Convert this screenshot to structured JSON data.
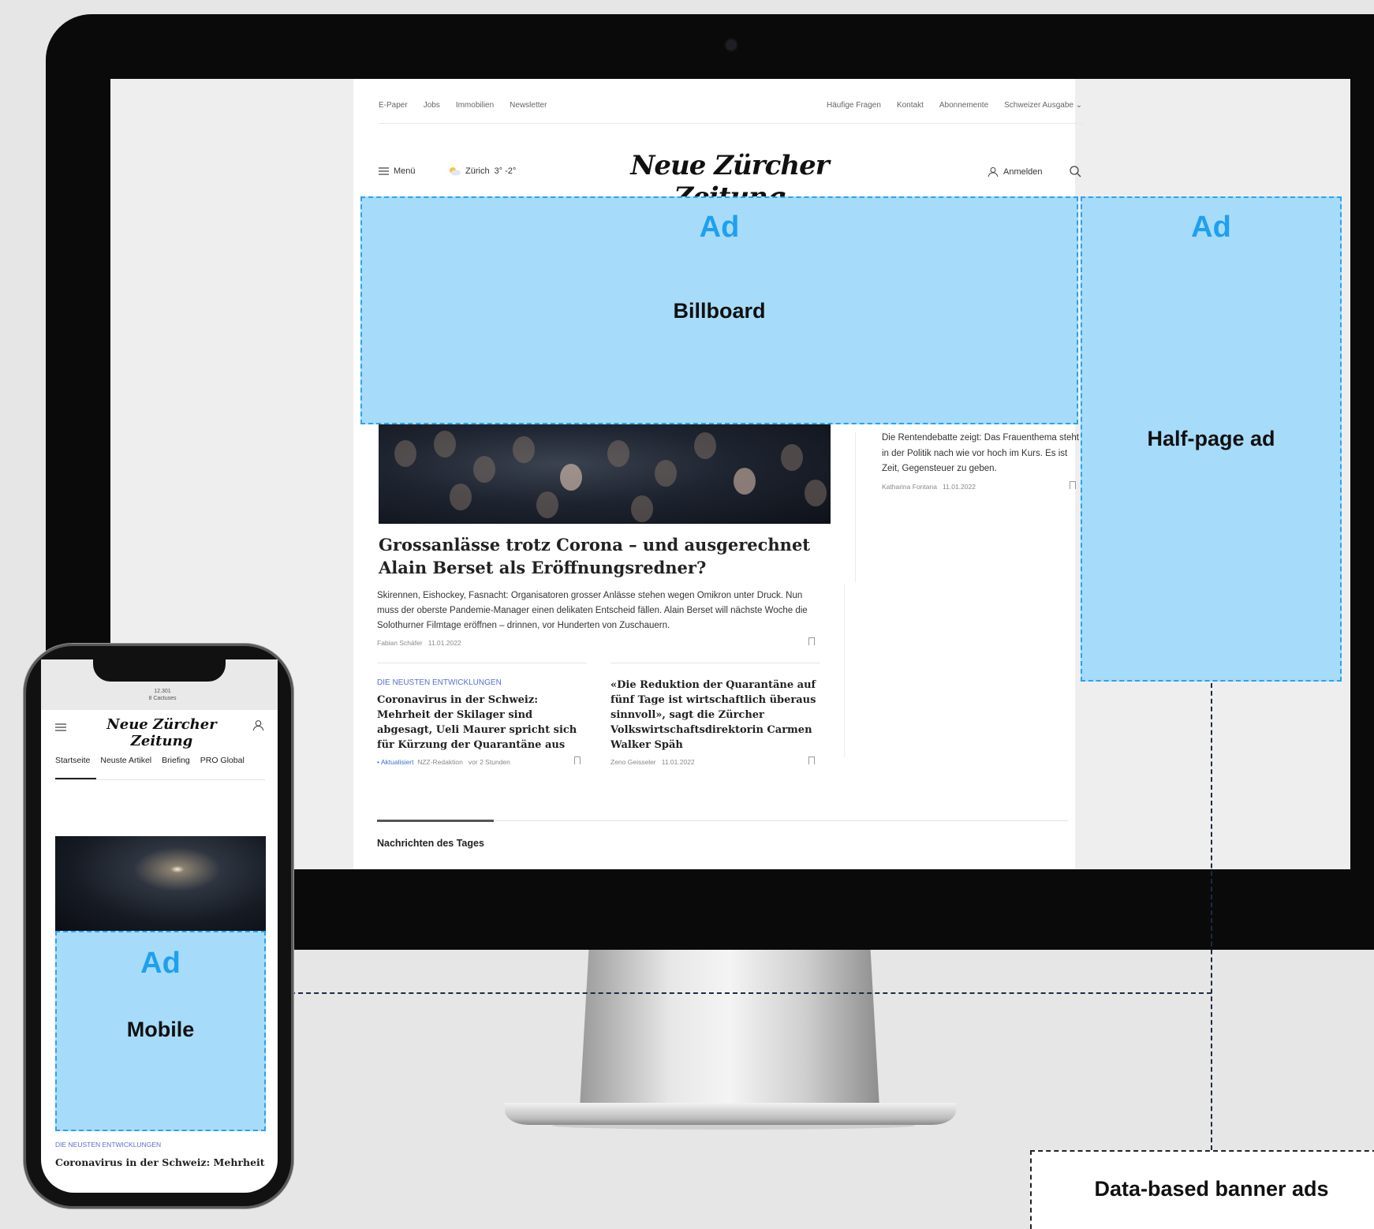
{
  "top_links_left": [
    "E-Paper",
    "Jobs",
    "Immobilien",
    "Newsletter"
  ],
  "top_links_right": [
    "Häufige Fragen",
    "Kontakt",
    "Abonnemente",
    "Schweizer Ausgabe"
  ],
  "header": {
    "menu_label": "Menü",
    "weather": "Zürich",
    "temperature": "3° -2°",
    "logo": "Neue Zürcher Zeitung",
    "login_label": "Anmelden"
  },
  "ads": {
    "billboard": {
      "tag": "Ad",
      "label": "Billboard"
    },
    "half_page": {
      "tag": "Ad",
      "label": "Half-page ad"
    },
    "mobile": {
      "tag": "Ad",
      "label": "Mobile"
    },
    "callout": "Data-based banner ads",
    "color_fill": "#a6dcf9",
    "color_accent": "#2aa2ee"
  },
  "main_article": {
    "headline": "Grossanlässe trotz Corona – und ausgerechnet Alain Berset als Eröffnungsredner?",
    "lead": "Skirennen, Eishockey, Fasnacht: Organisatoren grosser Anlässe stehen wegen Omikron unter Druck. Nun muss der oberste Pandemie-Manager einen delikaten Entscheid fällen. Alain Berset will nächste Woche die Solothurner Filmtage eröffnen – drinnen, vor Hunderten von Zuschauern.",
    "author": "Fabian Schäfer",
    "date": "11.01.2022"
  },
  "side_article": {
    "text": "Die Rentendebatte zeigt: Das Frauenthema steht in der Politik nach wie vor hoch im Kurs. Es ist Zeit, Gegensteuer zu geben.",
    "author": "Katharina Fontana",
    "date": "11.01.2022"
  },
  "teaser_left": {
    "kicker": "DIE NEUSTEN ENTWICKLUNGEN",
    "headline": "Coronavirus in der Schweiz: Mehrheit der Skilager sind abgesagt, Ueli Maurer spricht sich für Kürzung der Quarantäne aus",
    "status": "• Aktualisiert",
    "author": "NZZ-Redaktion",
    "time": "vor 2 Stunden"
  },
  "teaser_right": {
    "headline": "«Die Reduktion der Quarantäne auf fünf Tage ist wirtschaftlich überaus sinnvoll», sagt die Zürcher Volkswirtschaftsdirektorin Carmen Walker Späh",
    "author": "Zeno Geisseler",
    "date": "11.01.2022"
  },
  "section_title": "Nachrichten des Tages",
  "phone": {
    "status_line1": "12.301",
    "status_line2": "8 Cactuses",
    "logo": "Neue Zürcher Zeitung",
    "tabs": [
      "Startseite",
      "Neuste Artikel",
      "Briefing",
      "PRO Global"
    ],
    "kicker": "DIE NEUSTEN ENTWICKLUNGEN",
    "headline": "Coronavirus in der Schweiz: Mehrheit"
  }
}
